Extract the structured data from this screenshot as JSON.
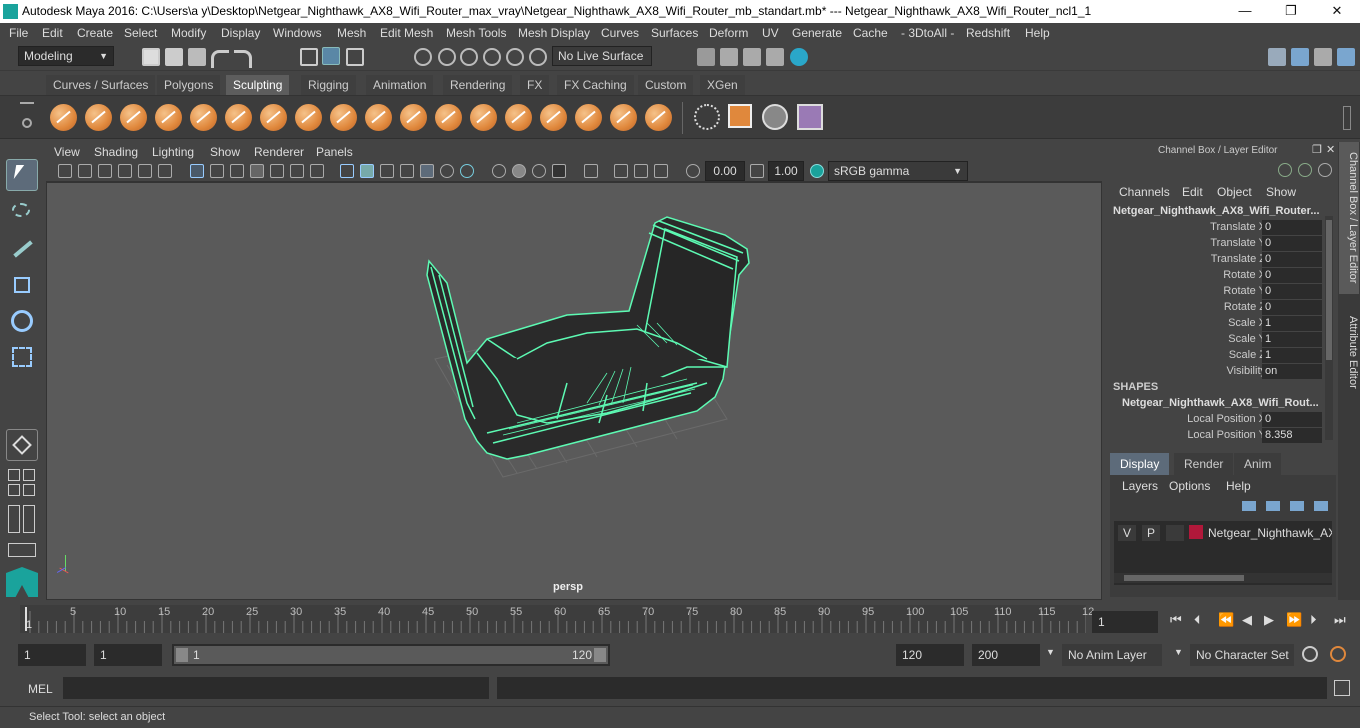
{
  "window": {
    "title": "Autodesk Maya 2016: C:\\Users\\a y\\Desktop\\Netgear_Nighthawk_AX8_Wifi_Router_max_vray\\Netgear_Nighthawk_AX8_Wifi_Router_mb_standart.mb*   ---   Netgear_Nighthawk_AX8_Wifi_Router_ncl1_1",
    "minimize": "—",
    "maximize": "❐",
    "close": "✕"
  },
  "menu": [
    "File",
    "Edit",
    "Create",
    "Select",
    "Modify",
    "Display",
    "Windows",
    "Mesh",
    "Edit Mesh",
    "Mesh Tools",
    "Mesh Display",
    "Curves",
    "Surfaces",
    "Deform",
    "UV",
    "Generate",
    "Cache",
    "- 3DtoAll -",
    "Redshift",
    "Help"
  ],
  "status": {
    "mode": "Modeling",
    "live_surface": "No Live Surface"
  },
  "shelf_tabs": [
    "Curves / Surfaces",
    "Polygons",
    "Sculpting",
    "Rigging",
    "Animation",
    "Rendering",
    "FX",
    "FX Caching",
    "Custom",
    "XGen"
  ],
  "shelf_active": "Sculpting",
  "viewport": {
    "menu": [
      "View",
      "Shading",
      "Lighting",
      "Show",
      "Renderer",
      "Panels"
    ],
    "exposure": "0.00",
    "gamma": "1.00",
    "color_space": "sRGB gamma",
    "camera": "persp"
  },
  "channel_box": {
    "title": "Channel Box / Layer Editor",
    "menu": [
      "Channels",
      "Edit",
      "Object",
      "Show"
    ],
    "object": "Netgear_Nighthawk_AX8_Wifi_Router...",
    "attrs": [
      {
        "name": "Translate X",
        "value": "0"
      },
      {
        "name": "Translate Y",
        "value": "0"
      },
      {
        "name": "Translate Z",
        "value": "0"
      },
      {
        "name": "Rotate X",
        "value": "0"
      },
      {
        "name": "Rotate Y",
        "value": "0"
      },
      {
        "name": "Rotate Z",
        "value": "0"
      },
      {
        "name": "Scale X",
        "value": "1"
      },
      {
        "name": "Scale Y",
        "value": "1"
      },
      {
        "name": "Scale Z",
        "value": "1"
      },
      {
        "name": "Visibility",
        "value": "on"
      }
    ],
    "shapes_label": "SHAPES",
    "shape_name": "Netgear_Nighthawk_AX8_Wifi_Rout...",
    "shape_attrs": [
      {
        "name": "Local Position X",
        "value": "0"
      },
      {
        "name": "Local Position Y",
        "value": "8.358"
      }
    ]
  },
  "side_tabs": [
    "Channel Box / Layer Editor",
    "Attribute Editor"
  ],
  "layer_editor": {
    "tabs": [
      "Display",
      "Render",
      "Anim"
    ],
    "menu": [
      "Layers",
      "Options",
      "Help"
    ],
    "layer": {
      "v": "V",
      "p": "P",
      "name": "Netgear_Nighthawk_AX8",
      "color": "#b0183a"
    }
  },
  "timeline": {
    "ticks": [
      "5",
      "10",
      "15",
      "20",
      "25",
      "30",
      "35",
      "40",
      "45",
      "50",
      "55",
      "60",
      "65",
      "70",
      "75",
      "80",
      "85",
      "90",
      "95",
      "100",
      "105",
      "110",
      "115",
      "12"
    ],
    "start_marker": "1",
    "current": "1"
  },
  "range": {
    "start": "1",
    "playback_start": "1",
    "slider_start": "1",
    "slider_end": "120",
    "end": "120",
    "max": "200",
    "anim_layer": "No Anim Layer",
    "char_set": "No Character Set"
  },
  "cmd": {
    "label": "MEL"
  },
  "help": "Select Tool: select an object"
}
